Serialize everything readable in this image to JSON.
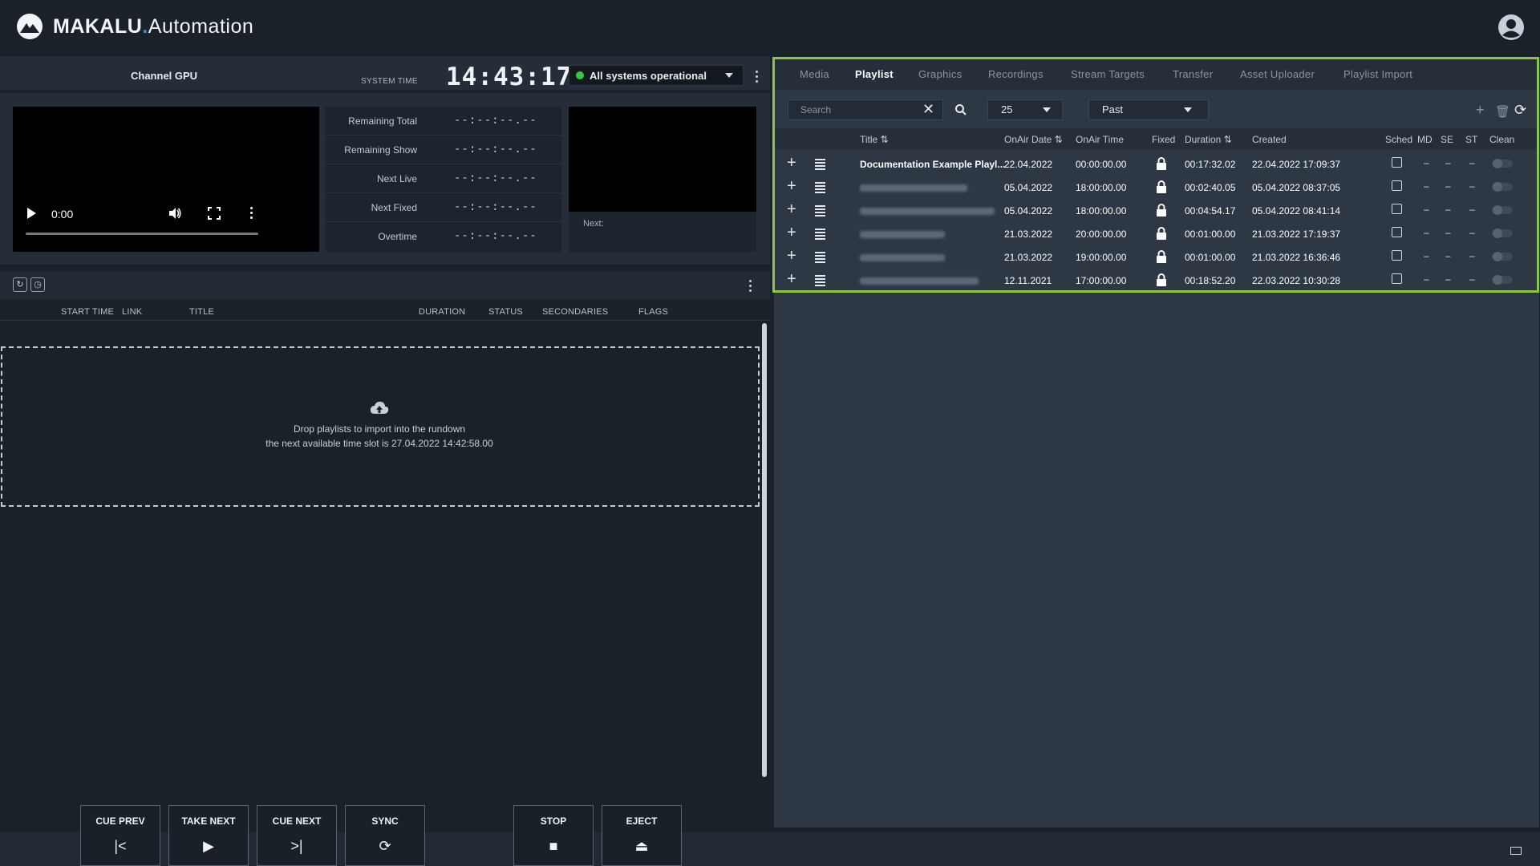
{
  "app": {
    "brand": "MAKALU",
    "dot": ".",
    "suffix": "Automation"
  },
  "channel": {
    "title": "Channel GPU",
    "system_time_label": "SYSTEM TIME",
    "system_time": "14:43:17",
    "status": "All systems operational",
    "status_color": "#2ecc40"
  },
  "video": {
    "time": "0:00"
  },
  "timers": [
    {
      "label": "Remaining Total",
      "value": "--:--:--.--"
    },
    {
      "label": "Remaining Show",
      "value": "--:--:--.--"
    },
    {
      "label": "Next Live",
      "value": "--:--:--.--"
    },
    {
      "label": "Next Fixed",
      "value": "--:--:--.--"
    },
    {
      "label": "Overtime",
      "value": "--:--:--.--"
    }
  ],
  "preview": {
    "next_label": "Next:"
  },
  "rundown": {
    "columns": [
      "START TIME",
      "LINK",
      "TITLE",
      "DURATION",
      "STATUS",
      "SECONDARIES",
      "FLAGS"
    ],
    "drop_line1": "Drop playlists to import into the rundown",
    "drop_line2": "the next available time slot is 27.04.2022 14:42:58.00"
  },
  "controls": [
    {
      "label": "CUE PREV",
      "icon": "skip-previous-icon"
    },
    {
      "label": "TAKE NEXT",
      "icon": "play-icon"
    },
    {
      "label": "CUE NEXT",
      "icon": "skip-next-icon"
    },
    {
      "label": "SYNC",
      "icon": "sync-icon"
    },
    {
      "label": "STOP",
      "icon": "stop-icon"
    },
    {
      "label": "EJECT",
      "icon": "eject-icon"
    }
  ],
  "tabs": [
    "Media",
    "Playlist",
    "Graphics",
    "Recordings",
    "Stream Targets",
    "Transfer",
    "Asset Uploader",
    "Playlist Import"
  ],
  "active_tab": "Playlist",
  "filters": {
    "search_placeholder": "Search",
    "page_size": "25",
    "period": "Past"
  },
  "playlist_columns": {
    "title": "Title",
    "onair_date": "OnAir Date",
    "onair_time": "OnAir Time",
    "fixed": "Fixed",
    "duration": "Duration",
    "created": "Created",
    "sched": "Sched",
    "md": "MD",
    "se": "SE",
    "st": "ST",
    "clean": "Clean"
  },
  "playlists": [
    {
      "title": "Documentation Example Playl...",
      "date": "22.04.2022",
      "time": "00:00:00.00",
      "duration": "00:17:32.02",
      "created": "22.04.2022 17:09:37",
      "md": "–",
      "se": "–",
      "st": "–"
    },
    {
      "title": "",
      "date": "05.04.2022",
      "time": "18:00:00.00",
      "duration": "00:02:40.05",
      "created": "05.04.2022 08:37:05",
      "md": "–",
      "se": "–",
      "st": "–"
    },
    {
      "title": "",
      "date": "05.04.2022",
      "time": "18:00:00.00",
      "duration": "00:04:54.17",
      "created": "05.04.2022 08:41:14",
      "md": "–",
      "se": "–",
      "st": "–"
    },
    {
      "title": "",
      "date": "21.03.2022",
      "time": "20:00:00.00",
      "duration": "00:01:00.00",
      "created": "21.03.2022 17:19:37",
      "md": "–",
      "se": "–",
      "st": "–"
    },
    {
      "title": "",
      "date": "21.03.2022",
      "time": "19:00:00.00",
      "duration": "00:01:00.00",
      "created": "21.03.2022 16:36:46",
      "md": "–",
      "se": "–",
      "st": "–"
    },
    {
      "title": "",
      "date": "12.11.2021",
      "time": "17:00:00.00",
      "duration": "00:18:52.20",
      "created": "22.03.2022 10:30:28",
      "md": "–",
      "se": "–",
      "st": "–"
    }
  ]
}
